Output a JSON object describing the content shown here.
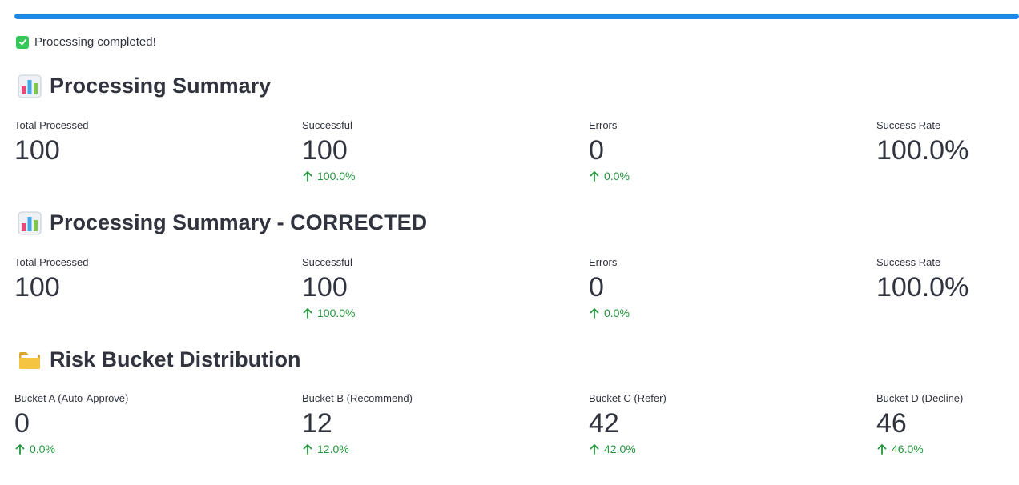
{
  "progress": {
    "fraction": 1.0
  },
  "status": {
    "icon": "check-icon",
    "text": "Processing completed!"
  },
  "summary": {
    "icon": "bar-chart-icon",
    "title": "Processing Summary",
    "metrics": [
      {
        "label": "Total Processed",
        "value": "100",
        "delta": ""
      },
      {
        "label": "Successful",
        "value": "100",
        "delta": "100.0%"
      },
      {
        "label": "Errors",
        "value": "0",
        "delta": "0.0%"
      },
      {
        "label": "Success Rate",
        "value": "100.0%",
        "delta": ""
      }
    ]
  },
  "summary_corrected": {
    "icon": "bar-chart-icon",
    "title": "Processing Summary - CORRECTED",
    "metrics": [
      {
        "label": "Total Processed",
        "value": "100",
        "delta": ""
      },
      {
        "label": "Successful",
        "value": "100",
        "delta": "100.0%"
      },
      {
        "label": "Errors",
        "value": "0",
        "delta": "0.0%"
      },
      {
        "label": "Success Rate",
        "value": "100.0%",
        "delta": ""
      }
    ]
  },
  "risk": {
    "icon": "folder-icon",
    "title": "Risk Bucket Distribution",
    "metrics": [
      {
        "label": "Bucket A (Auto-Approve)",
        "value": "0",
        "delta": "0.0%"
      },
      {
        "label": "Bucket B (Recommend)",
        "value": "12",
        "delta": "12.0%"
      },
      {
        "label": "Bucket C (Refer)",
        "value": "42",
        "delta": "42.0%"
      },
      {
        "label": "Bucket D (Decline)",
        "value": "46",
        "delta": "46.0%"
      }
    ]
  },
  "colors": {
    "accent": "#1f87e5",
    "delta_positive": "#21963b",
    "text": "#31333f"
  }
}
